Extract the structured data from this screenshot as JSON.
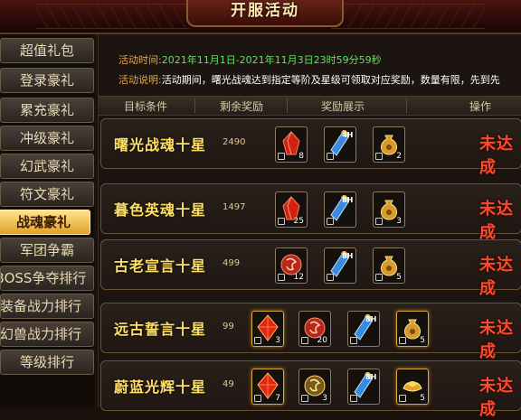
{
  "title": "开服活动",
  "sidebar": {
    "items": [
      {
        "label": "超值礼包"
      },
      {
        "label": "登录豪礼"
      },
      {
        "label": "累充豪礼"
      },
      {
        "label": "冲级豪礼"
      },
      {
        "label": "幻武豪礼"
      },
      {
        "label": "符文豪礼"
      },
      {
        "label": "战魂豪礼",
        "active": true
      },
      {
        "label": "军团争霸"
      },
      {
        "label": "BOSS争夺排行"
      },
      {
        "label": "装备战力排行"
      },
      {
        "label": "幻兽战力排行"
      },
      {
        "label": "等级排行"
      }
    ]
  },
  "info": {
    "time_label": "活动时间:",
    "time_value": "2021年11月1日-2021年11月3日23时59分59秒",
    "desc_label": "活动说明:",
    "desc_value": "活动期间，曙光战魂达到指定等阶及星级可领取对应奖励，数量有限，先到先"
  },
  "columns": [
    "目标条件",
    "剩余奖励",
    "奖励展示",
    "操作"
  ],
  "rows": [
    {
      "name": "曙光战魂十星",
      "remaining": "2490",
      "status": "未达成",
      "items": [
        {
          "icon": "red-gem-icon",
          "qty": "8"
        },
        {
          "icon": "blue-potion-icon",
          "hours": "4H",
          "qty": ""
        },
        {
          "icon": "gold-bag-icon",
          "qty": "2"
        }
      ]
    },
    {
      "name": "暮色英魂十星",
      "remaining": "1497",
      "status": "未达成",
      "items": [
        {
          "icon": "red-gem-icon",
          "qty": "25"
        },
        {
          "icon": "blue-potion-icon",
          "hours": "8H",
          "qty": ""
        },
        {
          "icon": "gold-bag-icon",
          "qty": "3"
        }
      ]
    },
    {
      "name": "古老宣言十星",
      "remaining": "499",
      "status": "未达成",
      "items": [
        {
          "icon": "red-rune-icon",
          "qty": "12"
        },
        {
          "icon": "blue-potion-icon",
          "hours": "8H",
          "qty": ""
        },
        {
          "icon": "gold-bag-icon",
          "qty": "5"
        }
      ]
    },
    {
      "name": "远古誓言十星",
      "remaining": "99",
      "status": "未达成",
      "items": [
        {
          "icon": "red-crystal-icon",
          "qty": "3"
        },
        {
          "icon": "red-rune-icon",
          "qty": "20"
        },
        {
          "icon": "blue-potion-icon",
          "hours": "8H",
          "qty": ""
        },
        {
          "icon": "gold-bag-icon",
          "qty": "5"
        }
      ]
    },
    {
      "name": "蔚蓝光辉十星",
      "remaining": "49",
      "status": "未达成",
      "items": [
        {
          "icon": "red-crystal-icon",
          "qty": "7"
        },
        {
          "icon": "gold-rune-icon",
          "qty": "3"
        },
        {
          "icon": "blue-potion-icon",
          "hours": "8H",
          "qty": ""
        },
        {
          "icon": "gold-ingot-icon",
          "qty": "5"
        }
      ]
    }
  ]
}
